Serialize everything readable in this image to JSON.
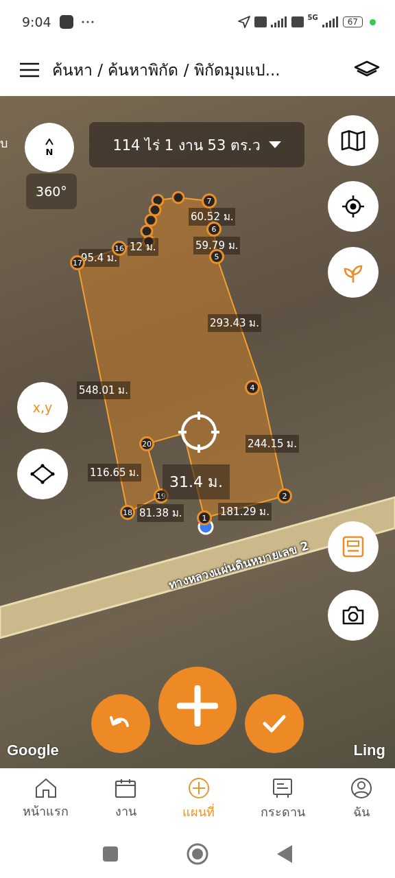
{
  "status_bar": {
    "time": "9:04",
    "network": "5G",
    "battery": "67"
  },
  "header": {
    "title": "ค้นหา / ค้นหาพิกัด / พิกัดมุมแป..."
  },
  "map": {
    "area_label": "114 ไร่ 1 งาน 53 ตร.ว",
    "compass_label": "N",
    "rotation_label": "360°",
    "coord_button": "x,y",
    "live_measurement": "31.4 ม.",
    "road_label": "ทางหลวงแผ่นดินหมายเลข 2",
    "place_label": "บ",
    "attribution": "Google",
    "brand_label": "Ling",
    "vertices": [
      {
        "label": "1"
      },
      {
        "label": "2"
      },
      {
        "label": "4"
      },
      {
        "label": "5"
      },
      {
        "label": "6"
      },
      {
        "label": "7"
      },
      {
        "label": "16"
      },
      {
        "label": "17"
      },
      {
        "label": "18"
      },
      {
        "label": "19"
      },
      {
        "label": "20"
      }
    ],
    "segment_labels": [
      "60.52 ม.",
      "59.79 ม.",
      "95.4 ม.",
      "12 ม.",
      "293.43 ม.",
      "548.01 ม.",
      "244.15 ม.",
      "116.65 ม.",
      "81.38 ม.",
      "181.29 ม."
    ]
  },
  "nav": [
    {
      "label": "หน้าแรก",
      "selected": false
    },
    {
      "label": "งาน",
      "selected": false
    },
    {
      "label": "แผนที่",
      "selected": true
    },
    {
      "label": "กระดาน",
      "selected": false
    },
    {
      "label": "ฉัน",
      "selected": false
    }
  ]
}
